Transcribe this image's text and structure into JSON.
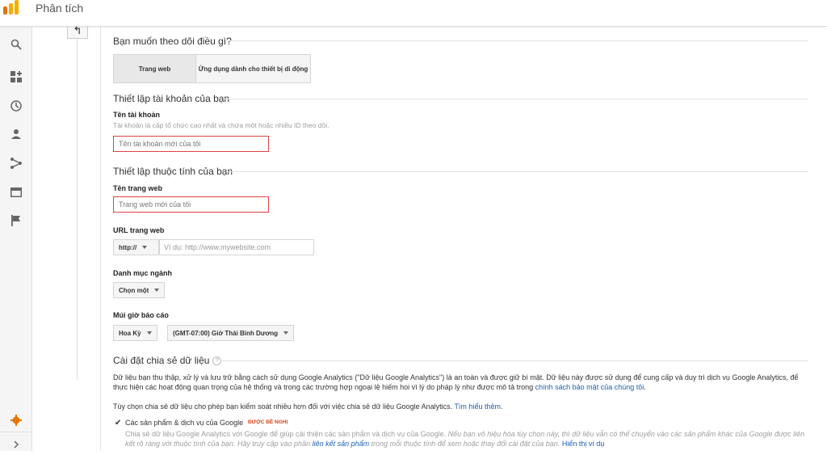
{
  "app": {
    "title": "Phân tích",
    "brand_color": "#f9ab00"
  },
  "rail": {
    "icons": [
      "search-icon",
      "customization-icon",
      "realtime-icon",
      "audience-icon",
      "acquisition-icon",
      "behavior-icon",
      "conversions-icon"
    ],
    "bottom_icons": [
      "settings-icon",
      "expand-icon"
    ]
  },
  "nav": {
    "back_glyph": "↰"
  },
  "tracking": {
    "title": "Bạn muốn theo dõi điều gì?",
    "tabs": [
      {
        "label": "Trang web"
      },
      {
        "label": "Ứng dụng dành cho thiết bị di động"
      }
    ]
  },
  "account": {
    "title": "Thiết lập tài khoản của bạn",
    "name_label": "Tên tài khoản",
    "name_help": "Tài khoản là cấp tổ chức cao nhất và chứa một hoặc nhiều ID theo dõi.",
    "name_placeholder": "Tên tài khoản mới của tôi"
  },
  "property": {
    "title": "Thiết lập thuộc tính của bạn",
    "site_label": "Tên trang web",
    "site_placeholder": "Trang web mới của tôi",
    "url_label": "URL trang web",
    "protocol": "http://",
    "url_placeholder": "Ví dụ: http://www.mywebsite.com",
    "industry_label": "Danh mục ngành",
    "industry_value": "Chọn một",
    "timezone_label": "Múi giờ báo cáo",
    "country_value": "Hoa Kỳ",
    "timezone_value": "(GMT-07:00) Giờ Thái Bình Dương"
  },
  "sharing": {
    "title": "Cài đặt chia sẻ dữ liệu",
    "help": "?",
    "desc1": "Dữ liệu bạn thu thập, xử lý và lưu trữ bằng cách sử dụng Google Analytics (\"Dữ liệu Google Analytics\") là an toàn và được giữ bí mật. Dữ liệu này được sử dụng để cung cấp và duy trì dịch vụ Google Analytics, để thực hiện các hoạt động quan trọng của hệ thống và trong các trường hợp ngoại lệ hiếm hoi vì lý do pháp lý như được mô tả trong",
    "desc1_link": "chính sách bảo mật của chúng tôi",
    "desc1_end": ".",
    "desc2": "Tùy chọn chia sẻ dữ liệu cho phép bạn kiểm soát nhiều hơn đối với việc chia sẻ dữ liệu Google Analytics.",
    "desc2_link": "Tìm hiểu thêm.",
    "option_label": "Các sản phẩm & dịch vụ của Google",
    "option_badge": "ĐƯỢC ĐỀ NGHỊ",
    "option_checked": true,
    "option_desc_a": "Chia sẻ dữ liệu Google Analytics với Google để giúp cải thiện các sản phẩm và dịch vụ của Google.",
    "option_desc_b": "Nếu bạn vô hiệu hóa tùy chọn này, thì dữ liệu vẫn có thể chuyển vào các sản phẩm khác của Google được liên kết rõ ràng với thuộc tính của bạn. Hãy truy cập vào phần",
    "option_desc_link": "liên kết sản phẩm",
    "option_desc_c": "trong mỗi thuộc tính để xem hoặc thay đổi cài đặt của bạn.",
    "option_desc_link2": "Hiển thị ví dụ"
  }
}
